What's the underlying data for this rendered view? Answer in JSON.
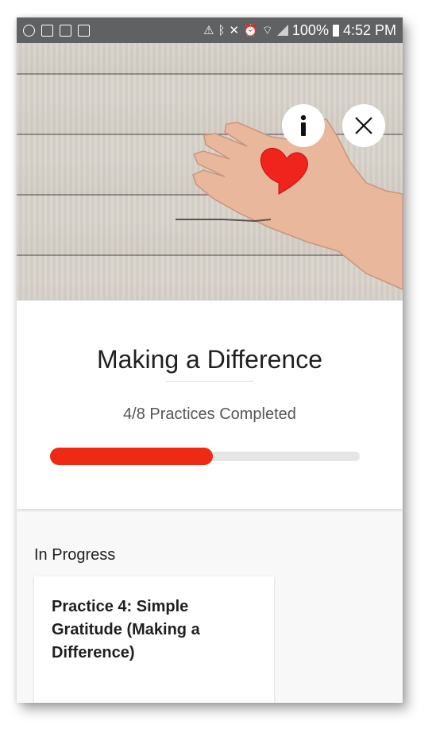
{
  "status_bar": {
    "battery": "100%",
    "time": "4:52 PM",
    "left_icons": [
      "app-icon",
      "calendar-icon",
      "pulse-icon",
      "battery-100-icon"
    ],
    "right_icons": [
      "alert-icon",
      "bluetooth-icon",
      "mute-icon",
      "alarm-icon",
      "wifi-icon",
      "signal-icon",
      "battery-icon"
    ]
  },
  "hero": {
    "info_icon": "info-icon",
    "close_icon": "close-icon"
  },
  "program": {
    "title": "Making a Difference",
    "progress_text": "4/8 Practices Completed",
    "completed": 4,
    "total": 8,
    "progress_fraction": 0.5,
    "accent_color": "#ee2a14"
  },
  "in_progress": {
    "label": "In Progress",
    "practices": [
      {
        "title": "Practice 4: Simple Gratitude (Making a Difference)"
      }
    ]
  }
}
